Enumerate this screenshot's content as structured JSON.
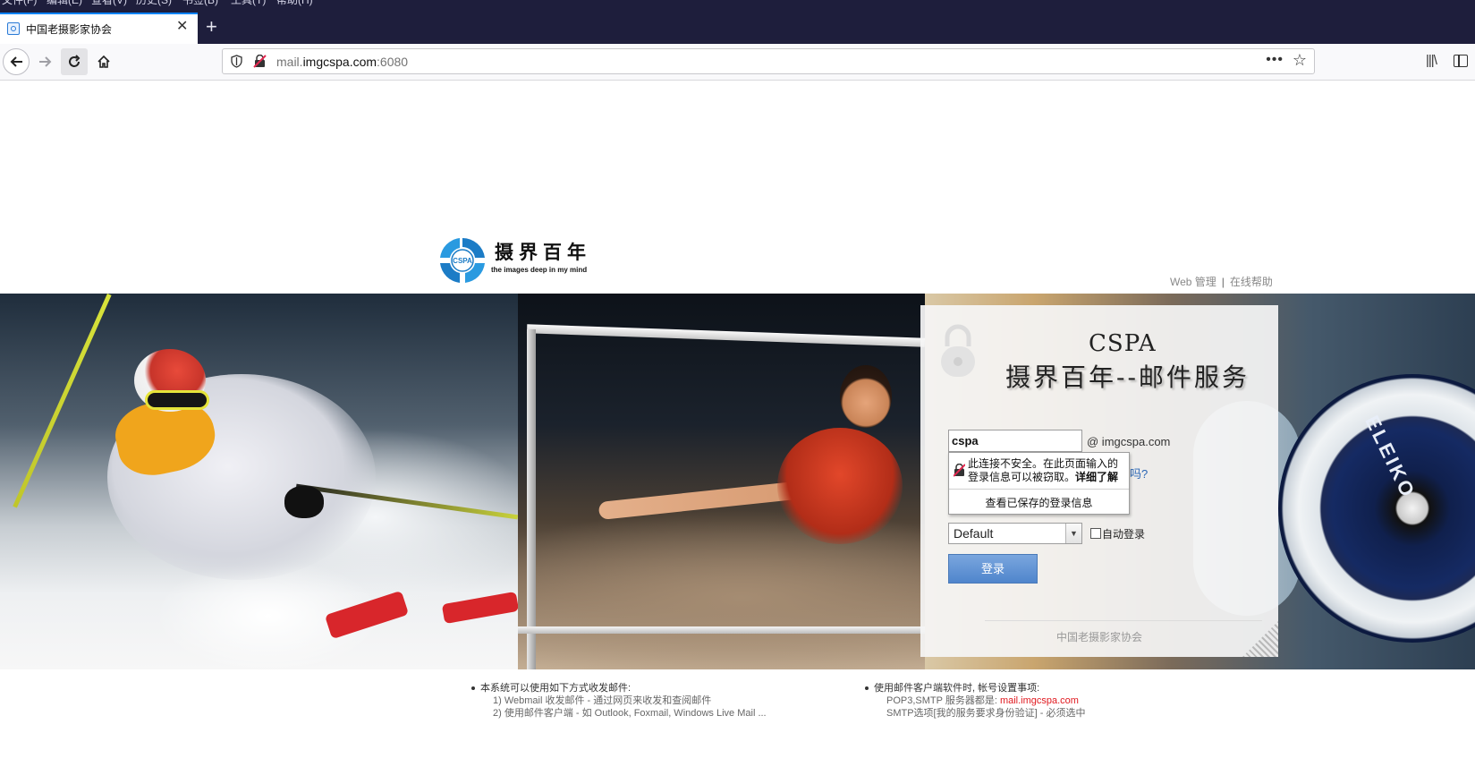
{
  "browser": {
    "menu": [
      "文件(F)",
      "编辑(E)",
      "查看(V)",
      "历史(S)",
      "书签(B)",
      "工具(T)",
      "帮助(H)"
    ],
    "tab_title": "中国老摄影家协会",
    "url_prefix": "mail.",
    "url_domain": "imgcspa.com",
    "url_port": ":6080",
    "url_more": "•••",
    "accent_color": "#0a84ff"
  },
  "header": {
    "logo_cn": "摄界百年",
    "logo_en": "the  images deep in  my mind",
    "logo_badge": "CSPA",
    "link_admin": "Web 管理",
    "separator": "|",
    "link_help": "在线帮助"
  },
  "banner": {
    "lift_plate_text": "ELEIKO"
  },
  "login": {
    "title_line1": "CSPA",
    "title_line2": "摄界百年--邮件服务",
    "username_value": "cspa",
    "domain_suffix": "@ imgcspa.com",
    "warning_text": "此连接不安全。在此页面输入的登录信息可以被窃取。",
    "warning_link": "详细了解",
    "saved_logins": "查看已保存的登录信息",
    "help_fragment": "吗?",
    "language_selected": "Default",
    "auto_login_label": "自动登录",
    "auto_login_checked": false,
    "submit_label": "登录",
    "footer": "中国老摄影家协会",
    "button_color": "#5b8fd2"
  },
  "info": {
    "left_title": "本系统可以使用如下方式收发邮件:",
    "left_line1": "1) Webmail 收发邮件 - 通过网页来收发和查阅邮件",
    "left_line2": "2) 使用邮件客户端 - 如 Outlook, Foxmail, Windows Live Mail ...",
    "right_title": "使用邮件客户端软件时, 帐号设置事项:",
    "right_line1_label": "POP3,SMTP 服务器都是: ",
    "right_line1_value": "mail.imgcspa.com",
    "right_line2": "SMTP选项[我的服务要求身份验证] - 必须选中"
  }
}
